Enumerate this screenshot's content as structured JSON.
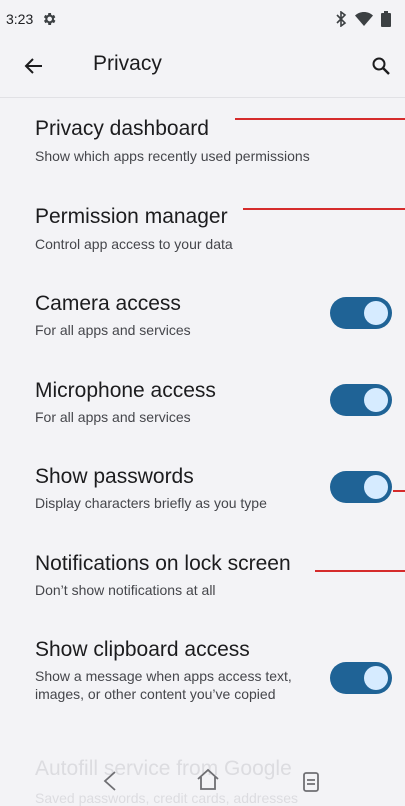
{
  "status_bar": {
    "time": "3:23",
    "icons": [
      "gear-icon",
      "bluetooth-icon",
      "wifi-icon",
      "battery-icon"
    ]
  },
  "app_bar": {
    "title": "Privacy",
    "back_icon": "arrow-left-icon",
    "search_icon": "search-icon"
  },
  "settings": [
    {
      "title": "Privacy dashboard",
      "subtitle": "Show which apps recently used permissions"
    },
    {
      "title": "Permission manager",
      "subtitle": "Control app access to your data"
    },
    {
      "title": "Camera access",
      "subtitle": "For all apps and services",
      "toggle": "on"
    },
    {
      "title": "Microphone access",
      "subtitle": "For all apps and services",
      "toggle": "on"
    },
    {
      "title": "Show passwords",
      "subtitle": "Display characters briefly as you type",
      "toggle": "on"
    },
    {
      "title": "Notifications on lock screen",
      "subtitle": "Don’t show notifications at all"
    },
    {
      "title": "Show clipboard access",
      "subtitle": "Show a message when apps access text, images, or other content you’ve copied",
      "toggle": "on"
    },
    {
      "title": "Autofill service from Google",
      "subtitle": "Saved passwords, credit cards, addresses"
    }
  ],
  "nav_bar": {
    "icons": [
      "back-chevron-icon",
      "home-icon",
      "recents-icon"
    ]
  },
  "colors": {
    "toggle_track": "#1f6396",
    "toggle_knob": "#d6ebff",
    "annotation_line": "#d52b2b",
    "background": "#f3f3f6"
  }
}
